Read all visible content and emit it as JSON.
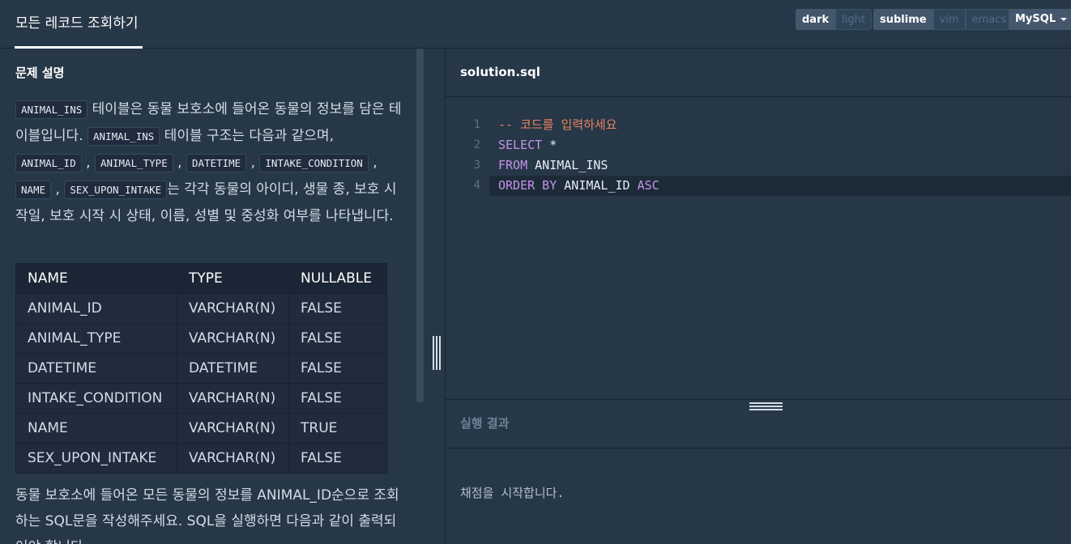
{
  "header": {
    "title": "모든 레코드 조회하기",
    "theme": {
      "dark": "dark",
      "light": "light"
    },
    "keymap": {
      "sublime": "sublime",
      "vim": "vim",
      "emacs": "emacs"
    },
    "language": "MySQL"
  },
  "problem": {
    "section_title": "문제 설명",
    "desc_parts": {
      "t1": "ANIMAL_INS",
      "p1": " 테이블은 동물 보호소에 들어온 동물의 정보를 담은 테이블입니다. ",
      "t2": "ANIMAL_INS",
      "p2": " 테이블 구조는 다음과 같으며, ",
      "t3": "ANIMAL_ID",
      "t4": "ANIMAL_TYPE",
      "t5": "DATETIME",
      "t6": "INTAKE_CONDITION",
      "t7": "NAME",
      "t8": "SEX_UPON_INTAKE",
      "p3": "는 각각 동물의 아이디, 생물 종, 보호 시작일, 보호 시작 시 상태, 이름, 성별 및 중성화 여부를 나타냅니다."
    },
    "table": {
      "headers": [
        "NAME",
        "TYPE",
        "NULLABLE"
      ],
      "rows": [
        [
          "ANIMAL_ID",
          "VARCHAR(N)",
          "FALSE"
        ],
        [
          "ANIMAL_TYPE",
          "VARCHAR(N)",
          "FALSE"
        ],
        [
          "DATETIME",
          "DATETIME",
          "FALSE"
        ],
        [
          "INTAKE_CONDITION",
          "VARCHAR(N)",
          "FALSE"
        ],
        [
          "NAME",
          "VARCHAR(N)",
          "TRUE"
        ],
        [
          "SEX_UPON_INTAKE",
          "VARCHAR(N)",
          "FALSE"
        ]
      ]
    },
    "desc2": "동물 보호소에 들어온 모든 동물의 정보를 ANIMAL_ID순으로 조회하는 SQL문을 작성해주세요. SQL을 실행하면 다음과 같이 출력되어야 합니다."
  },
  "editor": {
    "filename": "solution.sql",
    "lines": [
      {
        "num": "1",
        "comment": "-- 코드를 입력하세요"
      },
      {
        "num": "2",
        "kw": "SELECT",
        "rest": " *"
      },
      {
        "num": "3",
        "kw": "FROM",
        "rest": " ANIMAL_INS"
      },
      {
        "num": "4",
        "kw": "ORDER BY",
        "rest": " ANIMAL_ID ",
        "kw2": "ASC"
      }
    ]
  },
  "result": {
    "title": "실행 결과",
    "message": "채점을 시작합니다."
  },
  "colors": {
    "background": "#263747",
    "keyword": "#c792ea",
    "comment": "#e8845f"
  }
}
